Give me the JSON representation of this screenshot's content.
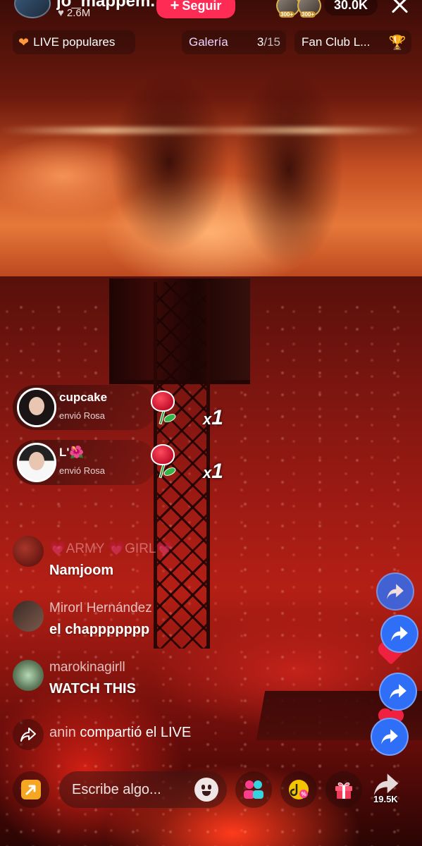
{
  "host": {
    "username": "jo_mappem..",
    "likes": "2.6M",
    "follow_label": "Seguir"
  },
  "viewers": {
    "badges": [
      "300+",
      "300+"
    ],
    "count": "30.0K"
  },
  "pills": {
    "popular": "LIVE populares",
    "gallery_label": "Galería",
    "gallery_index": "3",
    "gallery_total": "/15",
    "fanclub": "Fan Club L..."
  },
  "gifts": [
    {
      "name": "cupcake",
      "sub": "envió Rosa",
      "count": "1"
    },
    {
      "name": "L'🌺",
      "sub": "envió Rosa",
      "count": "1"
    }
  ],
  "comments": [
    {
      "user": "💗ARMY 💗GIRL💗",
      "text": "Namjoom"
    },
    {
      "user": "Mirorl Hernández",
      "text": "el chappppppp"
    },
    {
      "user": "marokinagirll",
      "text": "WATCH THIS"
    }
  ],
  "share_notice": {
    "user": "anin",
    "text": "compartió el LIVE"
  },
  "bottom_bar": {
    "input_placeholder": "Escribe algo...",
    "share_count": "19.5K"
  },
  "colors": {
    "accent": "#fe2c55",
    "share_blue": "#2f6ef6",
    "gift_box": "#f03a5a",
    "promo_yellow": "#f5c400"
  },
  "icons": [
    "heart-icon",
    "plus-icon",
    "close-icon",
    "heart-orange-icon",
    "trophy-icon",
    "rose-icon",
    "share-arrow-icon",
    "upload-arrow-icon",
    "emoji-icon",
    "multi-guest-icon",
    "promo-icon",
    "gift-box-icon"
  ]
}
